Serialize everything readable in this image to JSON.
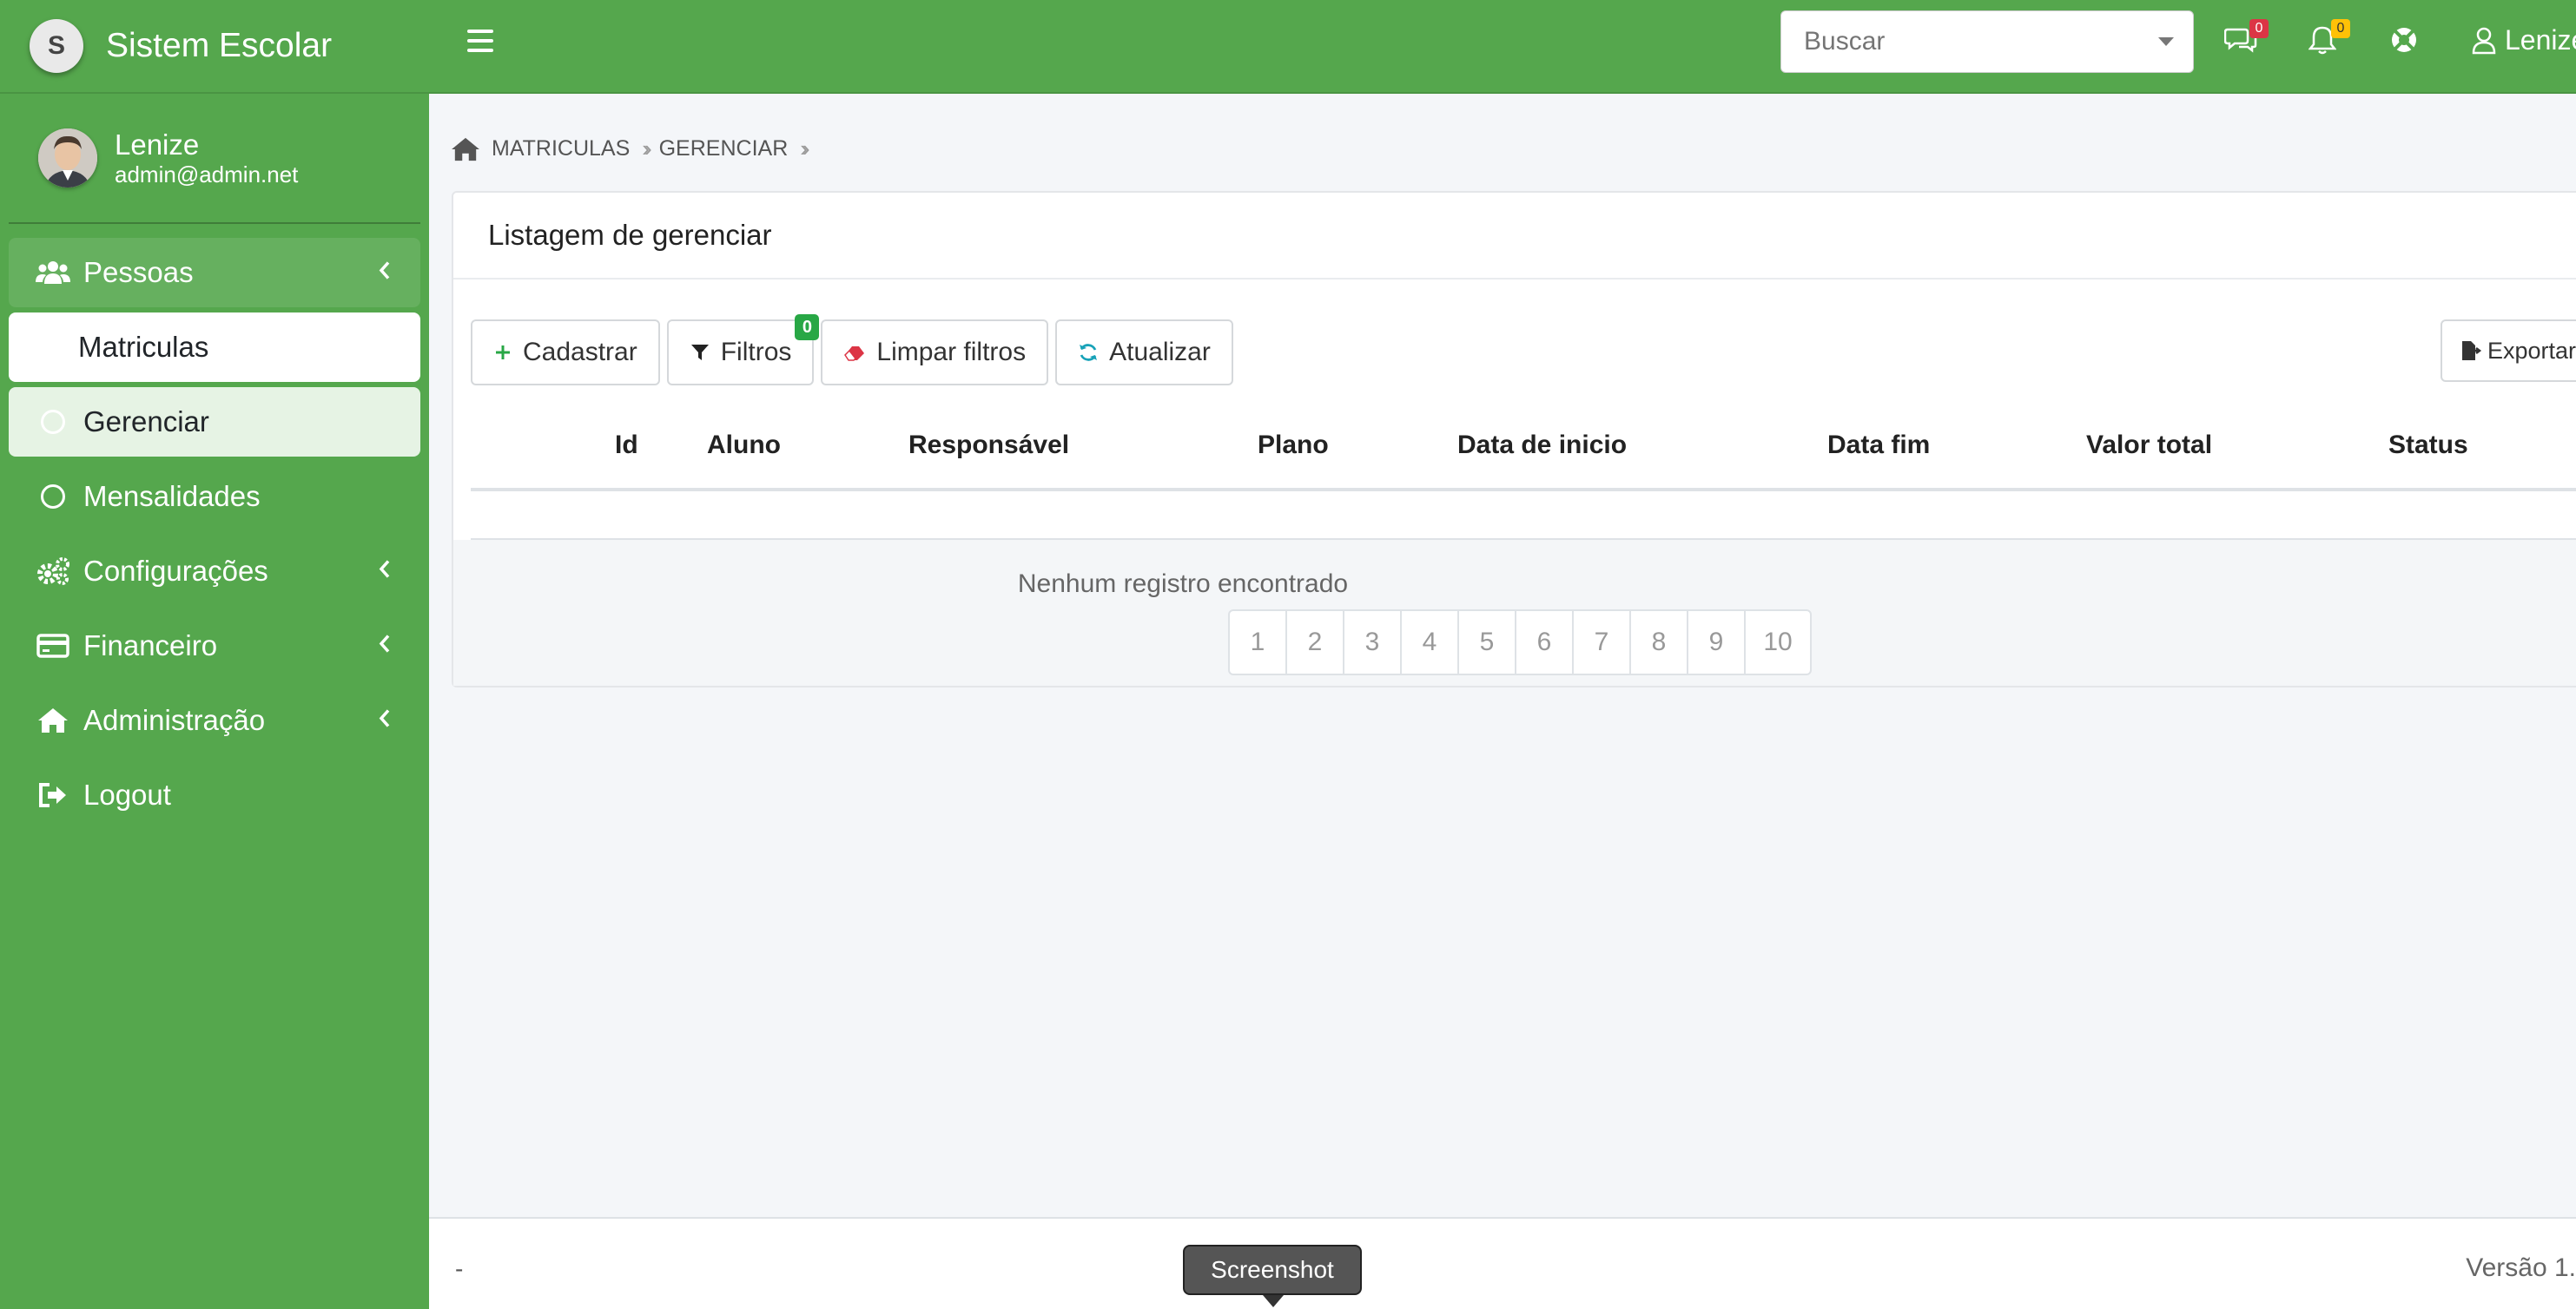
{
  "brand": {
    "logo_letter": "S",
    "name": "Sistem Escolar"
  },
  "user": {
    "name": "Lenize",
    "email": "admin@admin.net"
  },
  "sidebar": {
    "items": [
      {
        "label": "Pessoas",
        "icon": "users-icon",
        "arrow": "‹"
      },
      {
        "label": "Matriculas"
      },
      {
        "label": "Gerenciar",
        "icon": "circle-icon"
      },
      {
        "label": "Mensalidades",
        "icon": "circle-icon"
      },
      {
        "label": "Configurações",
        "icon": "cogs-icon",
        "arrow": "‹"
      },
      {
        "label": "Financeiro",
        "icon": "credit-card-icon",
        "arrow": "‹"
      },
      {
        "label": "Administração",
        "icon": "home-icon",
        "arrow": "‹"
      },
      {
        "label": "Logout",
        "icon": "sign-out-icon"
      }
    ]
  },
  "header": {
    "search_placeholder": "Buscar",
    "messages_count": "0",
    "notifications_count": "0",
    "user_label": "Lenize"
  },
  "breadcrumb": {
    "items": [
      "MATRICULAS",
      "GERENCIAR"
    ]
  },
  "card": {
    "title": "Listagem de gerenciar",
    "buttons": {
      "add": "Cadastrar",
      "filters": "Filtros",
      "filters_count": "0",
      "clear": "Limpar filtros",
      "refresh": "Atualizar",
      "export": "Exportar"
    },
    "columns": [
      "Id",
      "Aluno",
      "Responsável",
      "Plano",
      "Data de inicio",
      "Data fim",
      "Valor total",
      "Status"
    ],
    "empty_message": "Nenhum registro encontrado",
    "pages": [
      "1",
      "2",
      "3",
      "4",
      "5",
      "6",
      "7",
      "8",
      "9",
      "10"
    ]
  },
  "footer": {
    "left": "-",
    "right": "Versão 1."
  },
  "tooltip": "Screenshot",
  "colors": {
    "primary": "#55a74d",
    "danger": "#dc3545",
    "warning": "#ffc107",
    "success": "#28a745"
  }
}
